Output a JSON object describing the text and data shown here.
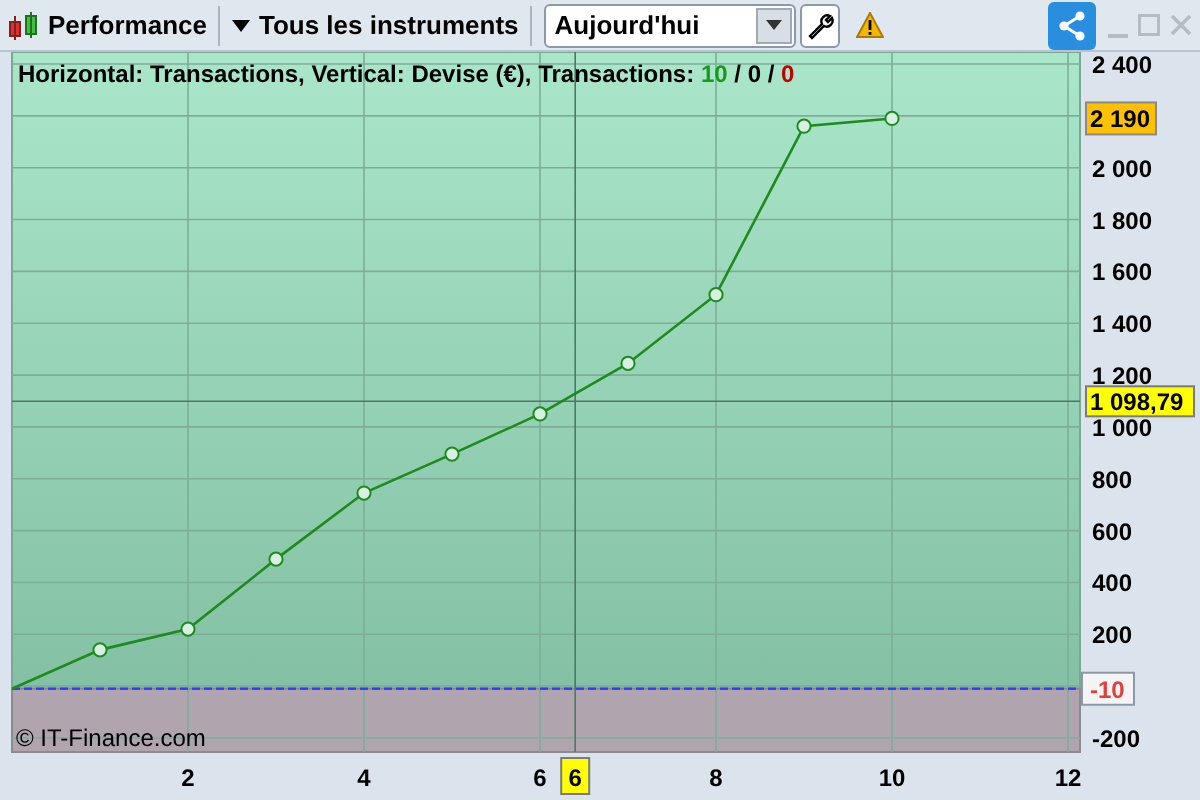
{
  "toolbar": {
    "title": "Performance",
    "instruments": "Tous les instruments",
    "period": {
      "value": "Aujourd'hui"
    }
  },
  "header": {
    "parts": [
      {
        "text": "Horizontal: Transactions, Vertical: Devise (€), Transactions: ",
        "color": "#000000"
      },
      {
        "text": "10",
        "color": "#1a9a1a"
      },
      {
        "text": " / ",
        "color": "#000000"
      },
      {
        "text": "0",
        "color": "#000000"
      },
      {
        "text": " / ",
        "color": "#000000"
      },
      {
        "text": "0",
        "color": "#c00000"
      }
    ]
  },
  "copyright": "© IT-Finance.com",
  "chart_data": {
    "type": "line",
    "x": [
      0,
      1,
      2,
      3,
      4,
      5,
      6,
      7,
      8,
      9,
      10
    ],
    "grid": true,
    "series": [
      {
        "color": "#1f8a1f",
        "marker": "o",
        "values": [
          -10,
          140,
          220,
          490,
          745,
          895,
          1050,
          1245,
          1510,
          2160,
          2190
        ]
      }
    ],
    "xlim": [
      0,
      12
    ],
    "ylim": [
      -200,
      2400
    ],
    "xticks": [
      2,
      4,
      6,
      8,
      10,
      12
    ],
    "yticks": [
      {
        "value": 2400,
        "label": "2 400"
      },
      {
        "value": 2000,
        "label": "2 000"
      },
      {
        "value": 1800,
        "label": "1 800"
      },
      {
        "value": 1600,
        "label": "1 600"
      },
      {
        "value": 1400,
        "label": "1 400"
      },
      {
        "value": 1200,
        "label": "1 200"
      },
      {
        "value": 1000,
        "label": "1 000"
      },
      {
        "value": 800,
        "label": "800"
      },
      {
        "value": 600,
        "label": "600"
      },
      {
        "value": 400,
        "label": "400"
      },
      {
        "value": 200,
        "label": "200"
      },
      {
        "value": -200,
        "label": "-200"
      }
    ],
    "annotations": [
      "2 190"
    ],
    "ref_lines": [
      {
        "axis": "y",
        "value": 1098.79,
        "label": "1 098,79"
      },
      {
        "axis": "x",
        "value": 6.4,
        "label": "6"
      },
      {
        "axis": "y",
        "value": -10,
        "label": "-10"
      }
    ]
  }
}
